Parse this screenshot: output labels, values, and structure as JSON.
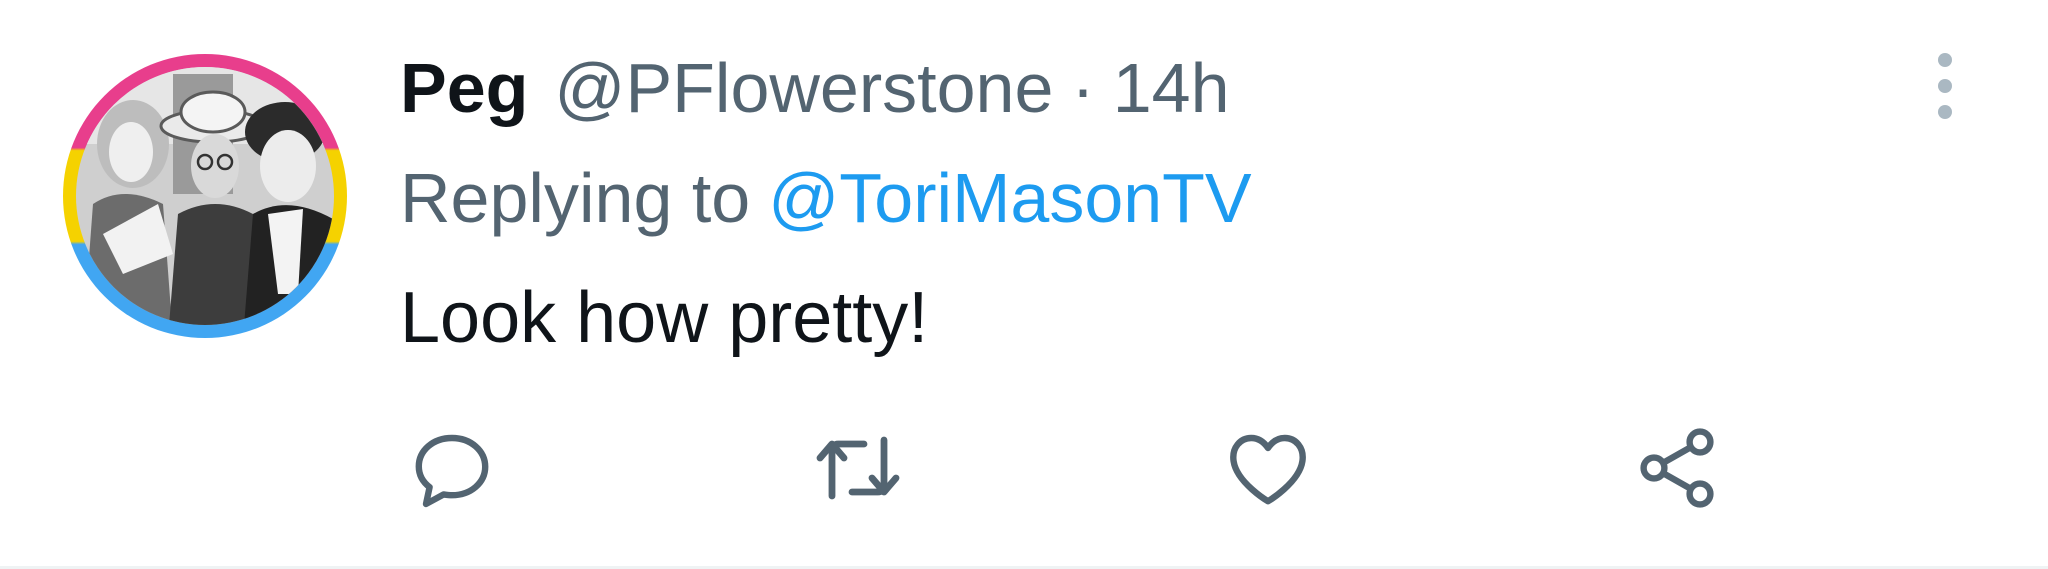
{
  "tweet": {
    "author_name": "Peg",
    "author_handle": "@PFlowerstone",
    "separator": "·",
    "timestamp": "14h",
    "replying_prefix": "Replying to",
    "replying_to": "@ToriMasonTV",
    "text": "Look how pretty!"
  },
  "actions": [
    {
      "icon": "reply-icon"
    },
    {
      "icon": "retweet-icon"
    },
    {
      "icon": "like-icon"
    },
    {
      "icon": "share-icon"
    }
  ],
  "colors": {
    "text_primary": "#0f1419",
    "text_secondary": "#536471",
    "link": "#1d9bf0",
    "avatar_ring_top": "#e83e8c",
    "avatar_ring_mid": "#f5d200",
    "avatar_ring_bottom": "#41a6f2"
  }
}
